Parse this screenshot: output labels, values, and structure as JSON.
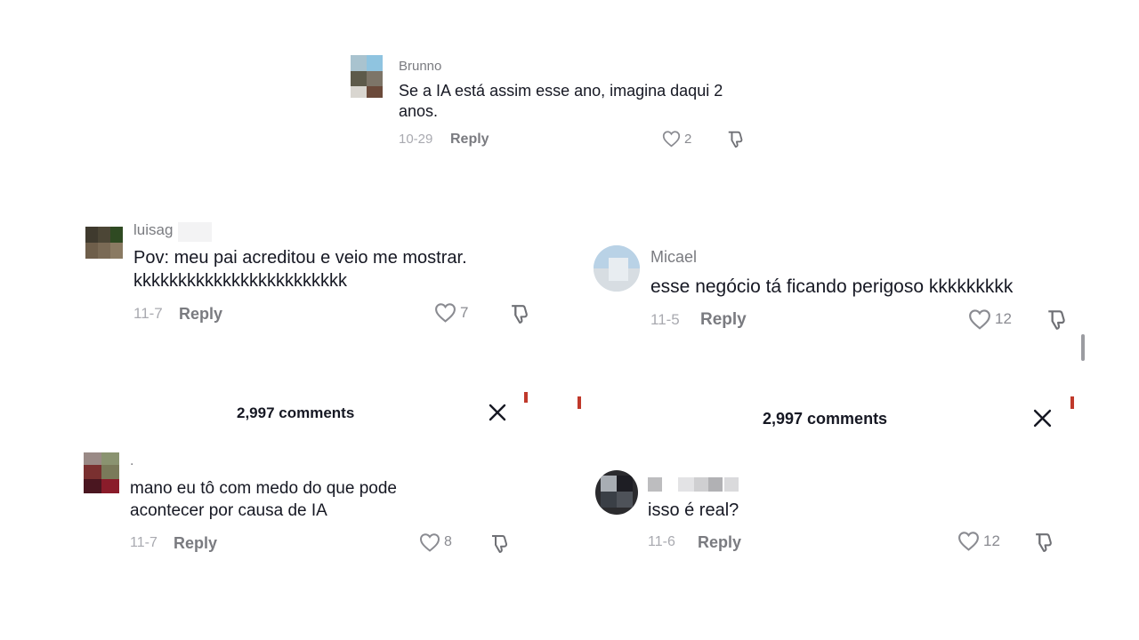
{
  "comments": [
    {
      "username": "Brunno",
      "text": "Se a IA está assim esse ano, imagina daqui 2 anos.",
      "date": "10-29",
      "reply_label": "Reply",
      "likes": "2"
    },
    {
      "username": "luisag",
      "text": "Pov: meu pai acreditou e veio me mostrar. kkkkkkkkkkkkkkkkkkkkkkkk",
      "date": "11-7",
      "reply_label": "Reply",
      "likes": "7"
    },
    {
      "username": "Micael",
      "text": "esse negócio tá ficando perigoso kkkkkkkkk",
      "date": "11-5",
      "reply_label": "Reply",
      "likes": "12"
    },
    {
      "username": ".",
      "text": "mano eu tô com medo do que pode acontecer por causa de IA",
      "date": "11-7",
      "reply_label": "Reply",
      "likes": "8"
    },
    {
      "username": "",
      "text": "isso é real?",
      "date": "11-6",
      "reply_label": "Reply",
      "likes": "12"
    }
  ],
  "panels": [
    {
      "title": "2,997 comments"
    },
    {
      "title": "2,997 comments"
    }
  ],
  "icons": {
    "like": "heart-outline-icon",
    "dislike": "thumbs-down-icon",
    "close": "close-x-icon"
  },
  "colors": {
    "text": "#161823",
    "muted": "#7a7b80",
    "date": "#a9aab0"
  }
}
